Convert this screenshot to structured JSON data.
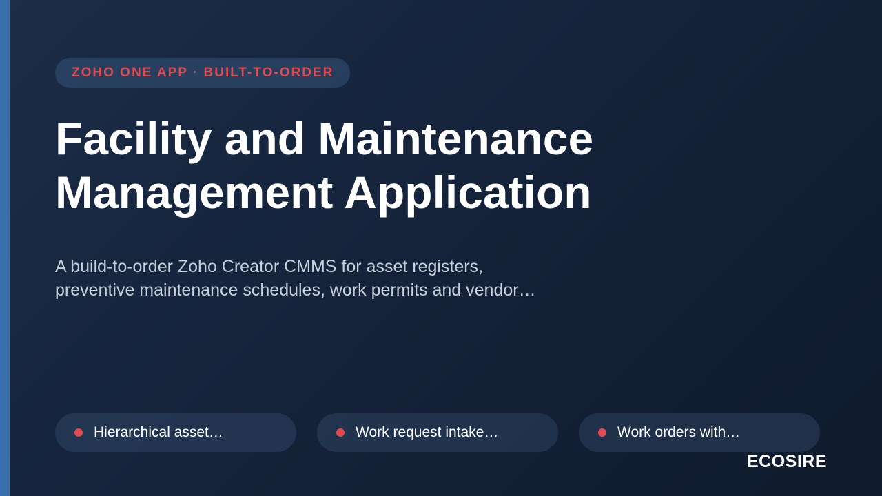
{
  "colors": {
    "background": "#15233b",
    "accent_bar": "#3a6fae",
    "highlight": "#e24a4f",
    "text": "#ffffff",
    "muted_text": "#c6cfdb"
  },
  "tag": {
    "label": "ZOHO ONE APP · BUILT-TO-ORDER"
  },
  "title": {
    "line1": "Facility and Maintenance",
    "line2": "Management Application"
  },
  "subtitle": {
    "line1": "A build-to-order Zoho Creator CMMS for asset registers,",
    "line2": "preventive maintenance schedules, work permits and vendor…"
  },
  "features": [
    {
      "label": "Hierarchical asset…",
      "icon": "bullet-dot"
    },
    {
      "label": "Work request intake…",
      "icon": "bullet-dot"
    },
    {
      "label": "Work orders with…",
      "icon": "bullet-dot"
    }
  ],
  "brand": {
    "name": "ECOSIRE"
  }
}
